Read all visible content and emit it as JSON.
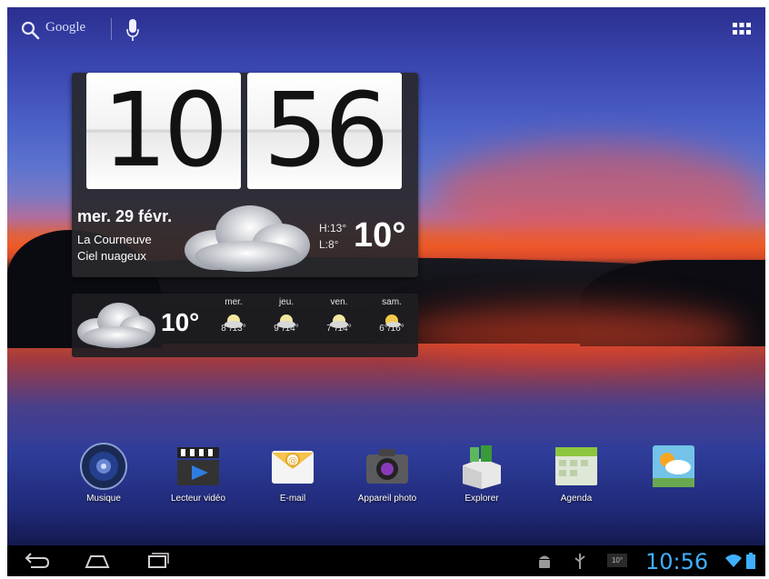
{
  "topbar": {
    "search_label": "Google"
  },
  "clock": {
    "hours": "10",
    "minutes": "56",
    "date": "mer. 29 févr.",
    "city": "La Courneuve",
    "condition": "Ciel nuageux",
    "high": "H:13°",
    "low": "L:8°",
    "temperature": "10°"
  },
  "forecast": {
    "current": "10°",
    "days": [
      {
        "name": "mer.",
        "range": "8°/13°"
      },
      {
        "name": "jeu.",
        "range": "9°/14°"
      },
      {
        "name": "ven.",
        "range": "7°/14°"
      },
      {
        "name": "sam.",
        "range": "6°/16°"
      }
    ]
  },
  "dock": [
    {
      "label": "Musique",
      "icon": "music-icon"
    },
    {
      "label": "Lecteur vidéo",
      "icon": "video-player-icon"
    },
    {
      "label": "E-mail",
      "icon": "email-icon"
    },
    {
      "label": "Appareil photo",
      "icon": "camera-icon"
    },
    {
      "label": "Explorer",
      "icon": "explorer-icon"
    },
    {
      "label": "Agenda",
      "icon": "calendar-icon"
    },
    {
      "label": "",
      "icon": "weather-app-icon"
    }
  ],
  "statusbar": {
    "time": "10:56",
    "temp_badge": "10°"
  },
  "colors": {
    "status_clock": "#3fb0ff",
    "widget_bg": "#28282c"
  }
}
